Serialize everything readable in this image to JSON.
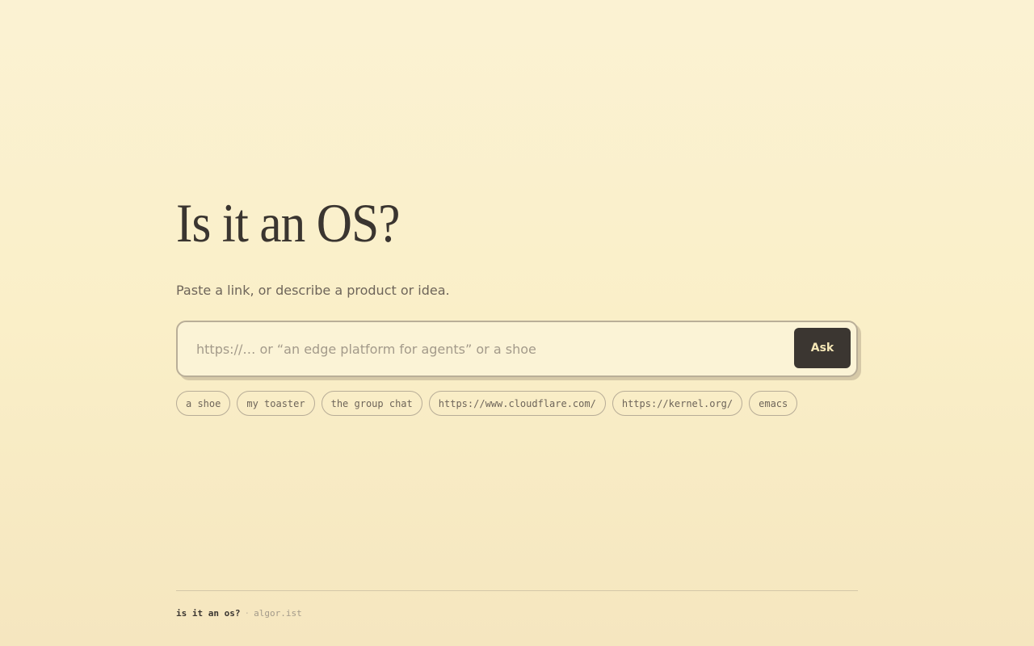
{
  "header": {
    "title": "Is it an OS?",
    "subtitle": "Paste a link, or describe a product or idea."
  },
  "search": {
    "placeholder": "https://… or “an edge platform for agents” or a shoe",
    "value": "",
    "button_label": "Ask"
  },
  "suggestions": [
    "a shoe",
    "my toaster",
    "the group chat",
    "https://www.cloudflare.com/",
    "https://kernel.org/",
    "emacs"
  ],
  "footer": {
    "name": "is it an os?",
    "separator": "·",
    "link": "algor.ist"
  },
  "colors": {
    "background": "#faefc8",
    "text": "#3a3530",
    "button": "#3b3631",
    "button_text": "#f6e8b7"
  }
}
